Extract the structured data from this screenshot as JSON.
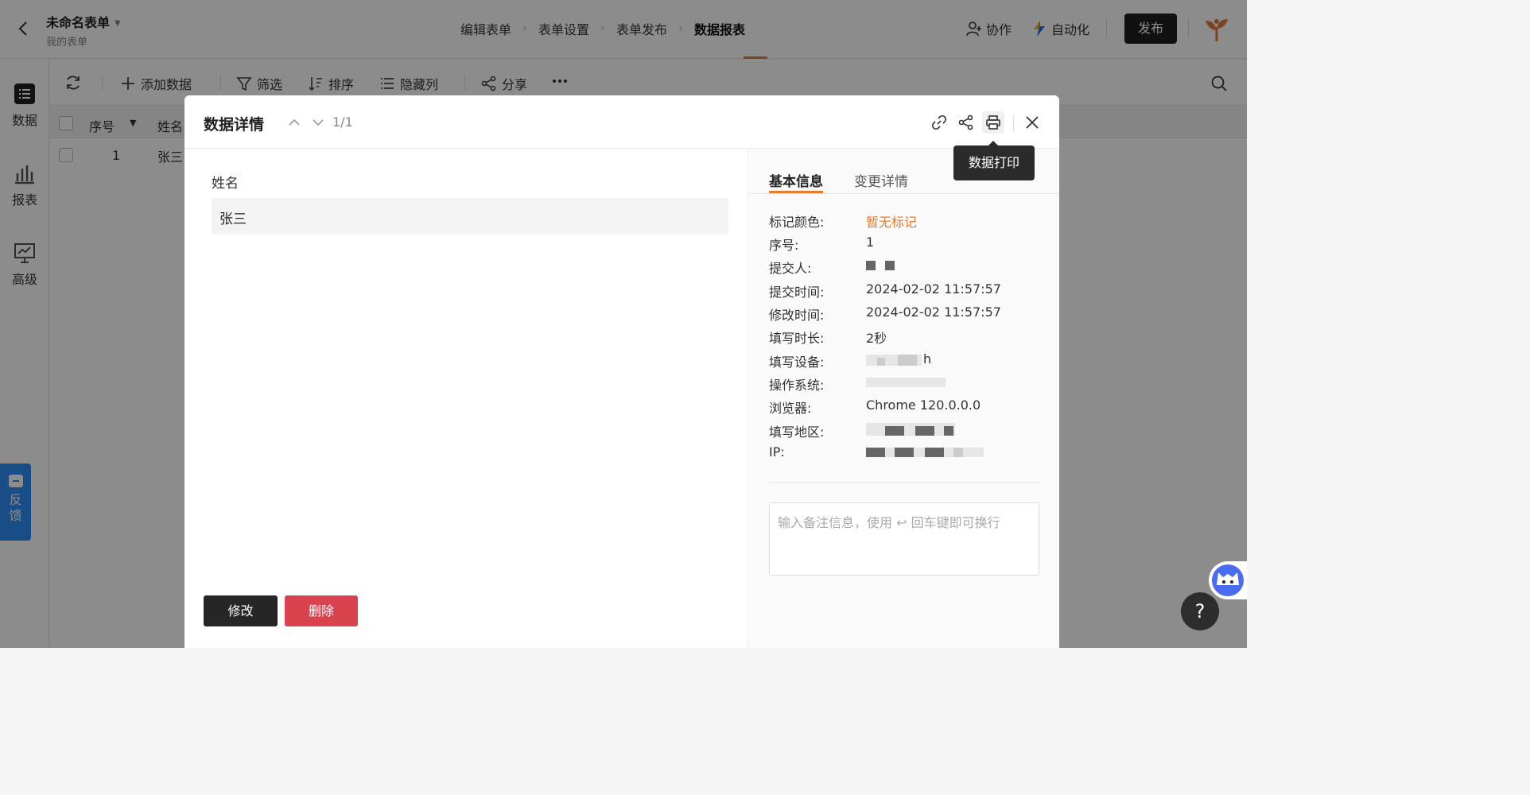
{
  "header": {
    "form_title": "未命名表单",
    "form_subtitle": "我的表单",
    "steps": [
      "编辑表单",
      "表单设置",
      "表单发布",
      "数据报表"
    ],
    "active_step": "数据报表",
    "collab_label": "协作",
    "automation_label": "自动化",
    "publish_label": "发布"
  },
  "sidebar": {
    "items": [
      {
        "label": "数据",
        "icon": "list-icon"
      },
      {
        "label": "报表",
        "icon": "bar-chart-icon"
      },
      {
        "label": "高级",
        "icon": "presentation-icon"
      }
    ],
    "feedback_label_1": "反",
    "feedback_label_2": "馈"
  },
  "toolbar": {
    "add_label": "添加数据",
    "filter_label": "筛选",
    "sort_label": "排序",
    "hide_label": "隐藏列",
    "share_label": "分享"
  },
  "table": {
    "col_seq": "序号",
    "col_name": "姓名",
    "rows": [
      {
        "seq": "1",
        "name": "张三"
      }
    ]
  },
  "modal": {
    "title": "数据详情",
    "pager": "1/1",
    "tooltip": "数据打印",
    "field_label": "姓名",
    "field_value": "张三",
    "edit_label": "修改",
    "delete_label": "删除",
    "tabs": [
      "基本信息",
      "变更详情"
    ],
    "info": {
      "mark_color_k": "标记颜色:",
      "mark_color_v": "暂无标记",
      "seq_k": "序号:",
      "seq_v": "1",
      "submitter_k": "提交人:",
      "submit_time_k": "提交时间:",
      "submit_time_v": "2024-02-02 11:57:57",
      "modify_time_k": "修改时间:",
      "modify_time_v": "2024-02-02 11:57:57",
      "duration_k": "填写时长:",
      "duration_v": "2秒",
      "device_k": "填写设备:",
      "device_v_tail": "h",
      "os_k": "操作系统:",
      "browser_k": "浏览器:",
      "browser_v": "Chrome 120.0.0.0",
      "region_k": "填写地区:",
      "ip_k": "IP:"
    },
    "remark_placeholder": "输入备注信息，使用 ↩ 回车键即可换行"
  },
  "help_label": "?",
  "colors": {
    "accent": "#e87a2c",
    "danger": "#d9434e",
    "dark": "#262626"
  }
}
